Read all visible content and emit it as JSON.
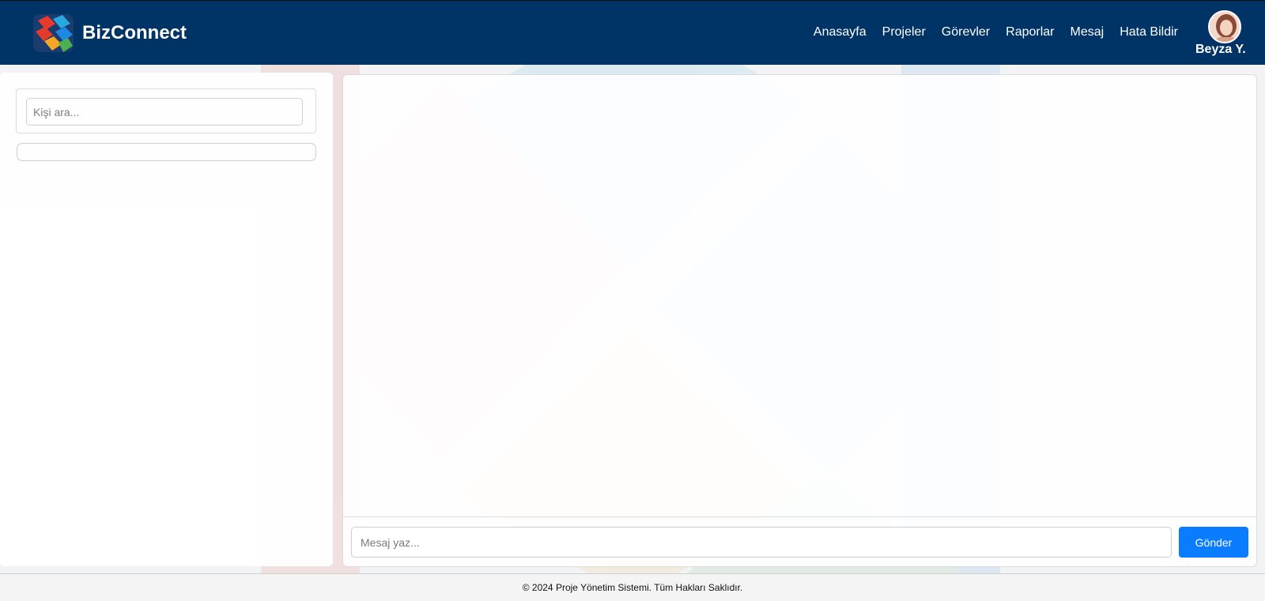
{
  "app": {
    "brand_name": "BizConnect"
  },
  "nav": {
    "items": [
      {
        "label": "Anasayfa"
      },
      {
        "label": "Projeler"
      },
      {
        "label": "Görevler"
      },
      {
        "label": "Raporlar"
      },
      {
        "label": "Mesaj"
      },
      {
        "label": "Hata Bildir"
      }
    ]
  },
  "user": {
    "name": "Beyza Y."
  },
  "sidebar": {
    "search_placeholder": "Kişi ara..."
  },
  "chat": {
    "message_placeholder": "Mesaj yaz...",
    "send_label": "Gönder"
  },
  "footer": {
    "text": "© 2024 Proje Yönetim Sistemi. Tüm Hakları Saklıdır."
  },
  "colors": {
    "navbar": "#003366",
    "send_button": "#0a7cff",
    "footer": "#f4f4f4"
  },
  "icons": {
    "brand_logo": "bizconnect-logo-icon",
    "avatar": "user-avatar"
  }
}
